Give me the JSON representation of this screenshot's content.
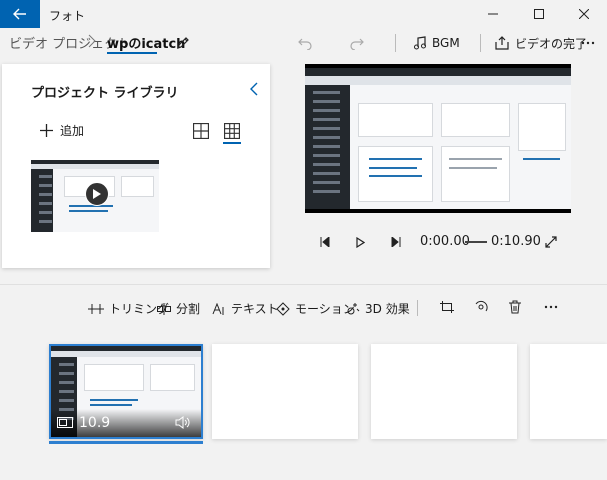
{
  "titlebar": {
    "title": "フォト",
    "icons": {
      "back": "back-arrow-icon",
      "minimize": "minimize-icon",
      "maximize": "maximize-icon",
      "close": "close-icon"
    }
  },
  "navbar": {
    "breadcrumb_root": "ビデオ プロジェクト",
    "project_name": "wpのicatch",
    "bgm_label": "BGM",
    "finish_label": "ビデオの完了",
    "icons": {
      "rename": "pencil-icon",
      "undo": "undo-icon",
      "redo": "redo-icon",
      "music": "music-note-icon",
      "export": "export-icon",
      "more": "more-icon"
    }
  },
  "library": {
    "title": "プロジェクト ライブラリ",
    "add_label": "追加",
    "icons": {
      "collapse": "chevron-left-icon",
      "add": "plus-icon",
      "grid_large": "grid-large-icon",
      "grid_small": "grid-small-icon",
      "play": "play-icon"
    }
  },
  "player": {
    "current_time": "0:00.00",
    "total_time": "0:10.90",
    "icons": {
      "skip_back": "skip-back-icon",
      "play": "play-icon",
      "skip_forward": "skip-forward-icon",
      "fullscreen": "fullscreen-icon"
    }
  },
  "storyboard": {
    "tools": [
      {
        "label": "トリミング",
        "icon": "trim-icon"
      },
      {
        "label": "分割",
        "icon": "split-icon"
      },
      {
        "label": "テキスト",
        "icon": "text-icon"
      },
      {
        "label": "モーション",
        "icon": "motion-icon"
      },
      {
        "label": "3D 効果",
        "icon": "3d-effects-icon"
      }
    ],
    "icons": {
      "resize": "resize-icon",
      "filter": "filter-icon",
      "delete": "trash-icon",
      "more": "more-icon"
    },
    "clip": {
      "duration": "10.9",
      "icons": {
        "type": "clip-type-icon",
        "audio": "volume-icon"
      }
    }
  },
  "colors": {
    "accent": "#0063b1",
    "selection": "#2d7fd0",
    "wp_admin": "#23282d"
  }
}
